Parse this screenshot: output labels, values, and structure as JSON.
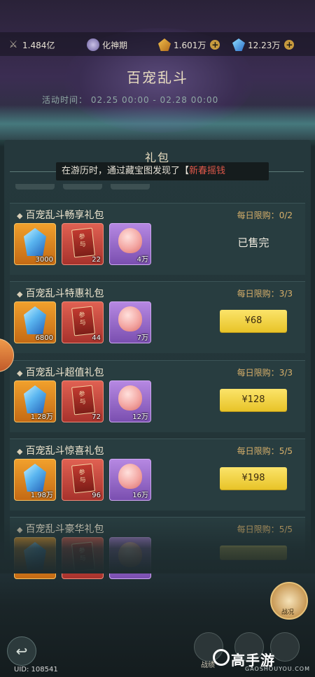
{
  "resources": [
    {
      "icon": "power-icon",
      "value": "1.484亿",
      "has_plus": false
    },
    {
      "icon": "realm-icon",
      "value": "化神期",
      "has_plus": false
    },
    {
      "icon": "gold-icon",
      "value": "1.601万",
      "has_plus": true
    },
    {
      "icon": "crystal-icon",
      "value": "12.23万",
      "has_plus": true
    }
  ],
  "event": {
    "title": "百宠乱斗",
    "time_label": "活动时间：",
    "time_range": "02.25 00:00 - 02.28 00:00"
  },
  "panel": {
    "title": "礼包",
    "notice_prefix": "在游历时，通过藏宝图发现了【",
    "notice_highlight": "新春摇钱"
  },
  "gifts": [
    {
      "name": "百宠乱斗畅享礼包",
      "limit_label": "每日限购：",
      "limit_value": "0/2",
      "items": [
        {
          "type": "crystal",
          "count": "3000"
        },
        {
          "type": "card",
          "count": "22",
          "card_text": "参与"
        },
        {
          "type": "peach",
          "count": "4万"
        }
      ],
      "status": "sold_out",
      "status_text": "已售完"
    },
    {
      "name": "百宠乱斗特惠礼包",
      "limit_label": "每日限购：",
      "limit_value": "3/3",
      "items": [
        {
          "type": "crystal",
          "count": "6800"
        },
        {
          "type": "card",
          "count": "44",
          "card_text": "参与"
        },
        {
          "type": "peach",
          "count": "7万"
        }
      ],
      "status": "buy",
      "price": "¥68"
    },
    {
      "name": "百宠乱斗超值礼包",
      "limit_label": "每日限购：",
      "limit_value": "3/3",
      "items": [
        {
          "type": "crystal",
          "count": "1.28万"
        },
        {
          "type": "card",
          "count": "72",
          "card_text": "参与"
        },
        {
          "type": "peach",
          "count": "12万"
        }
      ],
      "status": "buy",
      "price": "¥128"
    },
    {
      "name": "百宠乱斗惊喜礼包",
      "limit_label": "每日限购：",
      "limit_value": "5/5",
      "items": [
        {
          "type": "crystal",
          "count": "1.98万"
        },
        {
          "type": "card",
          "count": "96",
          "card_text": "参与"
        },
        {
          "type": "peach",
          "count": "16万"
        }
      ],
      "status": "buy",
      "price": "¥198"
    },
    {
      "name": "百宠乱斗豪华礼包",
      "limit_label": "每日限购：",
      "limit_value": "5/5",
      "items": [
        {
          "type": "crystal",
          "count": ""
        },
        {
          "type": "card",
          "count": "",
          "card_text": "参与"
        },
        {
          "type": "peach",
          "count": ""
        }
      ],
      "status": "buy",
      "price": ""
    }
  ],
  "bottom": {
    "uid": "UID: 108541",
    "battle_label": "战绩",
    "battle_main_label": "战况",
    "watermark": "高手游",
    "watermark_sub": "GAOSHOUYOU.COM"
  },
  "colors": {
    "price_button": "#f5d83c",
    "limit_text": "#d8b06a",
    "highlight": "#e0584a"
  }
}
